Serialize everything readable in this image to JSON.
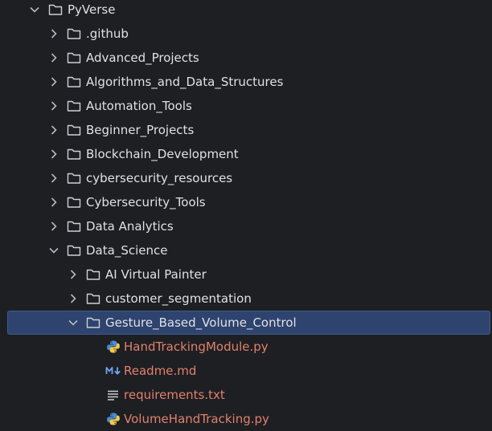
{
  "project_tree": {
    "root": {
      "label": "PyVerse"
    },
    "top_folders": [
      {
        "label": ".github"
      },
      {
        "label": "Advanced_Projects"
      },
      {
        "label": "Algorithms_and_Data_Structures"
      },
      {
        "label": "Automation_Tools"
      },
      {
        "label": "Beginner_Projects"
      },
      {
        "label": "Blockchain_Development"
      },
      {
        "label": "cybersecurity_resources"
      },
      {
        "label": "Cybersecurity_Tools"
      },
      {
        "label": "Data Analytics"
      }
    ],
    "data_science": {
      "label": "Data_Science",
      "subfolders": [
        {
          "label": "AI Virtual Painter"
        },
        {
          "label": "customer_segmentation"
        }
      ],
      "selected_folder": {
        "label": "Gesture_Based_Volume_Control",
        "files": [
          {
            "label": "HandTrackingModule.py",
            "icon": "python-file-icon"
          },
          {
            "label": "Readme.md",
            "icon": "markdown-file-icon"
          },
          {
            "label": "requirements.txt",
            "icon": "text-file-icon"
          },
          {
            "label": "VolumeHandTracking.py",
            "icon": "python-file-icon"
          }
        ]
      }
    }
  },
  "colors": {
    "background": "#1e1f22",
    "selection": "#2e436e",
    "text": "#dfe1e5",
    "modified_file_text": "#e0806d",
    "markdown_icon": "#6fa3f2"
  }
}
